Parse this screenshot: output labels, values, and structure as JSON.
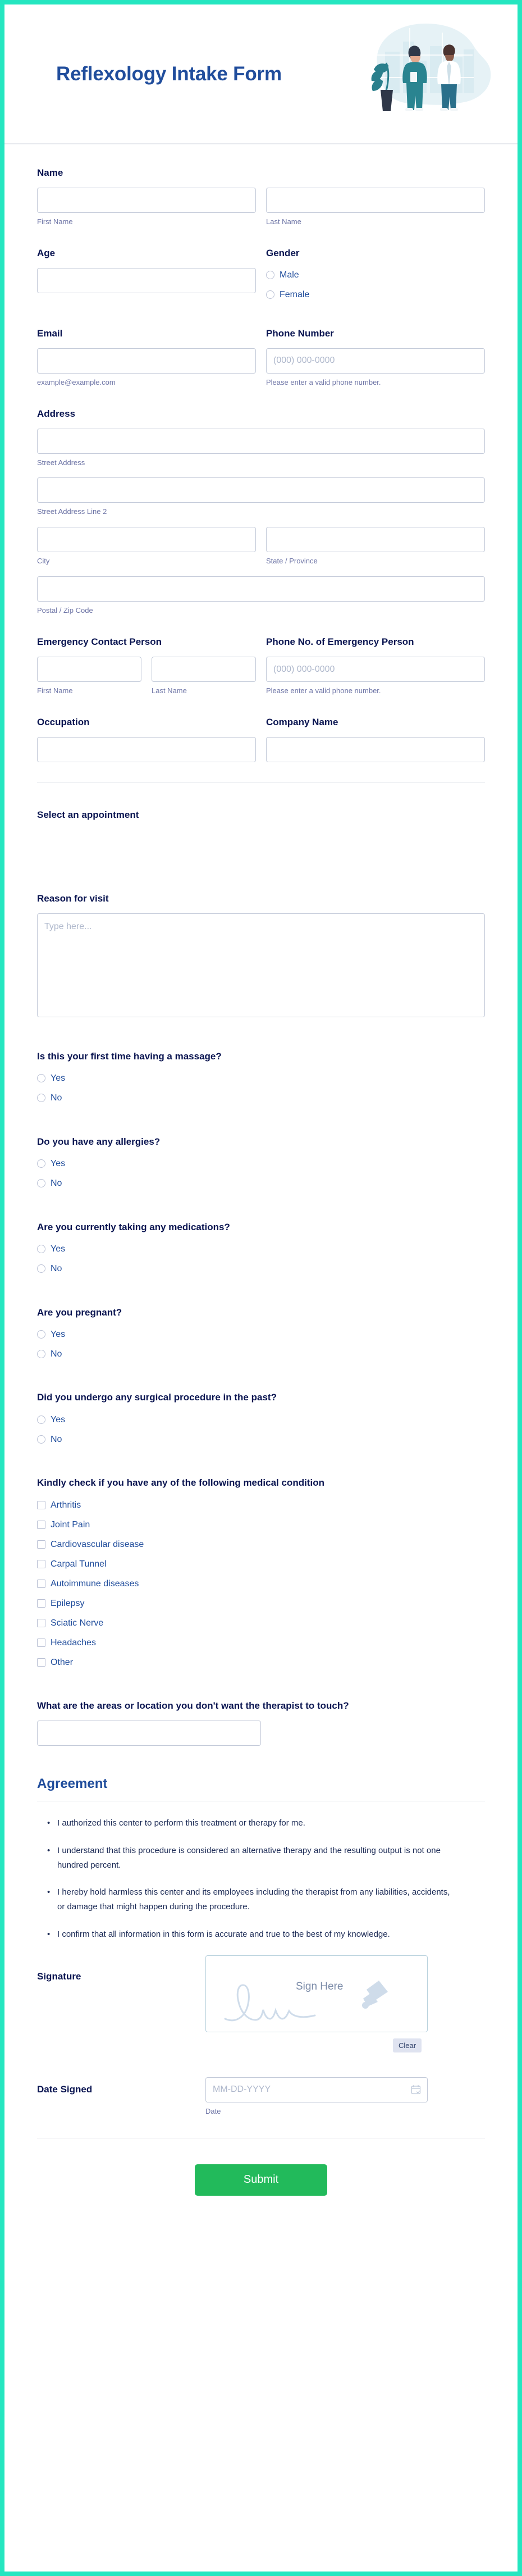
{
  "theme": {
    "page_border": "#25e6c0",
    "title_color": "#204d9c",
    "label_color": "#0a1551",
    "sublabel_color": "#6f76a7",
    "submit_color": "#22ba5b"
  },
  "header": {
    "title": "Reflexology Intake Form"
  },
  "fields": {
    "name": {
      "label": "Name",
      "first_sub": "First Name",
      "last_sub": "Last Name"
    },
    "age": {
      "label": "Age"
    },
    "gender": {
      "label": "Gender",
      "options": [
        "Male",
        "Female"
      ]
    },
    "email": {
      "label": "Email",
      "sub": "example@example.com"
    },
    "phone": {
      "label": "Phone Number",
      "placeholder": "(000) 000-0000",
      "sub": "Please enter a valid phone number."
    },
    "address": {
      "label": "Address",
      "street_sub": "Street Address",
      "street2_sub": "Street Address Line 2",
      "city_sub": "City",
      "state_sub": "State / Province",
      "zip_sub": "Postal / Zip Code"
    },
    "emergency_contact": {
      "label": "Emergency Contact Person",
      "first_sub": "First Name",
      "last_sub": "Last Name"
    },
    "emergency_phone": {
      "label": "Phone No. of Emergency Person",
      "placeholder": "(000) 000-0000",
      "sub": "Please enter a valid phone number."
    },
    "occupation": {
      "label": "Occupation"
    },
    "company": {
      "label": "Company Name"
    },
    "appointment": {
      "label": "Select an appointment"
    },
    "reason": {
      "label": "Reason for visit",
      "placeholder": "Type here..."
    },
    "avoid_areas": {
      "label": "What are the areas or location you don't want the therapist to touch?"
    }
  },
  "questions": [
    {
      "label": "Is this your first time having a massage?",
      "options": [
        "Yes",
        "No"
      ]
    },
    {
      "label": "Do you have any allergies?",
      "options": [
        "Yes",
        "No"
      ]
    },
    {
      "label": "Are you currently taking any medications?",
      "options": [
        "Yes",
        "No"
      ]
    },
    {
      "label": "Are you pregnant?",
      "options": [
        "Yes",
        "No"
      ]
    },
    {
      "label": "Did you undergo any surgical procedure in the past?",
      "options": [
        "Yes",
        "No"
      ]
    }
  ],
  "medical_conditions": {
    "label": "Kindly check if you have any of the following medical condition",
    "options": [
      "Arthritis",
      "Joint Pain",
      "Cardiovascular disease",
      "Carpal Tunnel",
      "Autoimmune diseases",
      "Epilepsy",
      "Sciatic Nerve",
      "Headaches",
      "Other"
    ]
  },
  "agreement": {
    "heading": "Agreement",
    "items": [
      "I authorized this center to perform this treatment or therapy for me.",
      "I understand that this procedure is considered an alternative therapy and the resulting output is not one hundred percent.",
      "I hereby hold harmless this center and its employees including the therapist from any liabilities, accidents, or damage that might happen during the procedure.",
      "I confirm that all information in this form is accurate and true to the best of my knowledge."
    ]
  },
  "signature": {
    "label": "Signature",
    "pad_text": "Sign Here",
    "clear_label": "Clear"
  },
  "date_signed": {
    "label": "Date Signed",
    "placeholder": "MM-DD-YYYY",
    "sub": "Date"
  },
  "submit": {
    "label": "Submit"
  }
}
